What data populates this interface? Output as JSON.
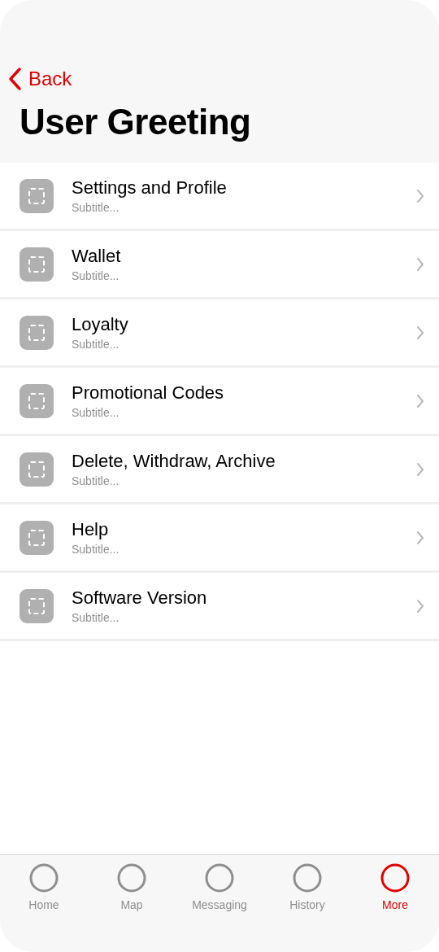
{
  "nav": {
    "back": "Back",
    "title": "User Greeting"
  },
  "items": [
    {
      "title": "Settings and Profile",
      "subtitle": "Subtitle..."
    },
    {
      "title": "Wallet",
      "subtitle": "Subtitle..."
    },
    {
      "title": "Loyalty",
      "subtitle": "Subtitle..."
    },
    {
      "title": "Promotional Codes",
      "subtitle": "Subtitle..."
    },
    {
      "title": "Delete, Withdraw, Archive",
      "subtitle": "Subtitle..."
    },
    {
      "title": "Help",
      "subtitle": "Subtitle..."
    },
    {
      "title": "Software Version",
      "subtitle": "Subtitle..."
    }
  ],
  "tab_bar": [
    {
      "label": "Home",
      "selected": false
    },
    {
      "label": "Map",
      "selected": false
    },
    {
      "label": "Messaging",
      "selected": false
    },
    {
      "label": "History",
      "selected": false
    },
    {
      "label": "More",
      "selected": true
    }
  ]
}
